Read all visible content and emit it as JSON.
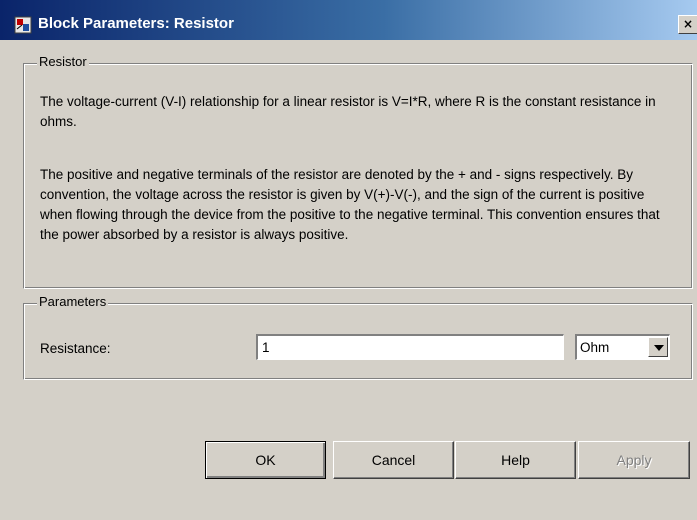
{
  "window": {
    "title": "Block Parameters: Resistor",
    "close_glyph": "×"
  },
  "description_group": {
    "legend": "Resistor",
    "paragraph1": "The voltage-current (V-I) relationship for a linear resistor is V=I*R, where R is the constant resistance in ohms.",
    "paragraph2": "The positive and negative terminals of the resistor are denoted by the + and - signs respectively. By convention, the voltage across the resistor is given by V(+)-V(-), and the sign of the current is positive when flowing through the device from the positive to the negative terminal. This convention ensures that the power absorbed by a resistor is always positive."
  },
  "parameters_group": {
    "legend": "Parameters",
    "resistance_label": "Resistance:",
    "resistance_value": "1",
    "unit_selected": "Ohm"
  },
  "buttons": {
    "ok": "OK",
    "cancel": "Cancel",
    "help": "Help",
    "apply": "Apply"
  },
  "colors": {
    "titlebar_start": "#0a246a",
    "titlebar_end": "#a6caf0",
    "dialog_face": "#d4d0c8"
  },
  "icons": {
    "title_icon": "simulink-block-icon",
    "close_icon": "close-icon",
    "dropdown_icon": "chevron-down-icon"
  }
}
